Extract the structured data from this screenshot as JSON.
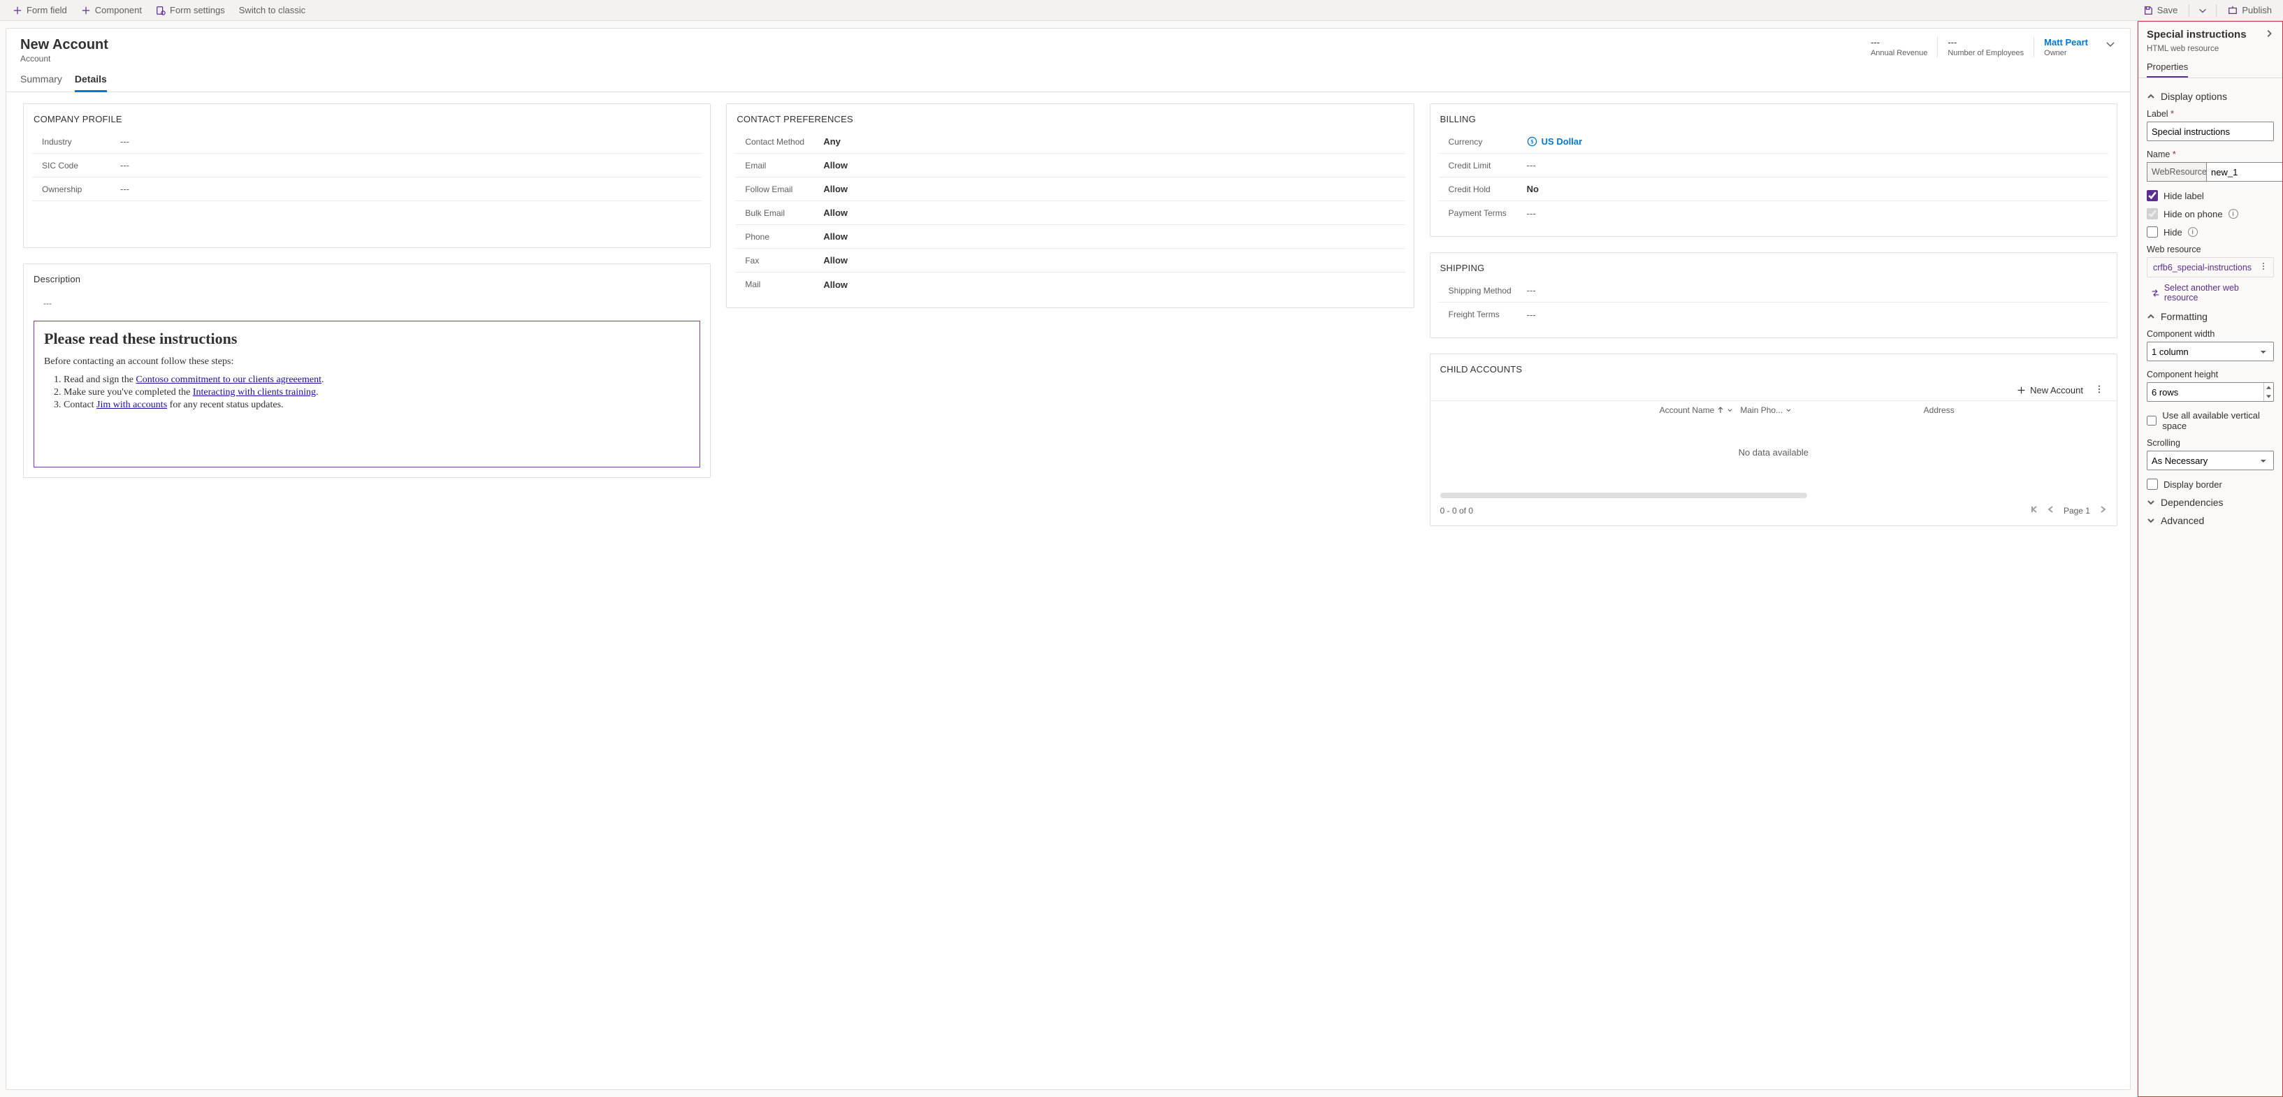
{
  "topbar": {
    "form_field": "Form field",
    "component": "Component",
    "form_settings": "Form settings",
    "switch_classic": "Switch to classic",
    "save": "Save",
    "publish": "Publish"
  },
  "header": {
    "title": "New Account",
    "subtitle": "Account",
    "fields": [
      {
        "value": "---",
        "label": "Annual Revenue"
      },
      {
        "value": "---",
        "label": "Number of Employees"
      },
      {
        "value": "Matt Peart",
        "label": "Owner",
        "link": true
      }
    ]
  },
  "tabs": {
    "summary": "Summary",
    "details": "Details"
  },
  "company_profile": {
    "title": "COMPANY PROFILE",
    "rows": [
      {
        "label": "Industry",
        "value": "---"
      },
      {
        "label": "SIC Code",
        "value": "---"
      },
      {
        "label": "Ownership",
        "value": "---"
      }
    ]
  },
  "contact_prefs": {
    "title": "CONTACT PREFERENCES",
    "rows": [
      {
        "label": "Contact Method",
        "value": "Any"
      },
      {
        "label": "Email",
        "value": "Allow"
      },
      {
        "label": "Follow Email",
        "value": "Allow"
      },
      {
        "label": "Bulk Email",
        "value": "Allow"
      },
      {
        "label": "Phone",
        "value": "Allow"
      },
      {
        "label": "Fax",
        "value": "Allow"
      },
      {
        "label": "Mail",
        "value": "Allow"
      }
    ]
  },
  "billing": {
    "title": "BILLING",
    "rows": [
      {
        "label": "Currency",
        "value": "US Dollar",
        "currency": true
      },
      {
        "label": "Credit Limit",
        "value": "---"
      },
      {
        "label": "Credit Hold",
        "value": "No"
      },
      {
        "label": "Payment Terms",
        "value": "---"
      }
    ]
  },
  "shipping": {
    "title": "SHIPPING",
    "rows": [
      {
        "label": "Shipping Method",
        "value": "---"
      },
      {
        "label": "Freight Terms",
        "value": "---"
      }
    ]
  },
  "description": {
    "title": "Description",
    "value": "---"
  },
  "webres": {
    "heading": "Please read these instructions",
    "intro": "Before contacting an account follow these steps:",
    "steps": {
      "s1a": "Read and sign the ",
      "s1link": "Contoso commitment to our clients agreeement",
      "s1b": ".",
      "s2a": "Make sure you've completed the ",
      "s2link": "Interacting with clients training",
      "s2b": ".",
      "s3a": "Contact ",
      "s3link": "Jim with accounts",
      "s3b": " for any recent status updates."
    }
  },
  "child_accounts": {
    "title": "CHILD ACCOUNTS",
    "add_label": "New Account",
    "columns": {
      "c1": "Account Name",
      "c2": "Main Pho...",
      "c3": "Address"
    },
    "empty": "No data available",
    "footer_count": "0 - 0 of 0",
    "page_label": "Page 1"
  },
  "props": {
    "title": "Special instructions",
    "subtitle": "HTML web resource",
    "tab": "Properties",
    "display_options": "Display options",
    "label_lbl": "Label",
    "label_val": "Special instructions",
    "name_lbl": "Name",
    "name_prefix": "WebResource_",
    "name_val": "new_1",
    "hide_label": "Hide label",
    "hide_on_phone": "Hide on phone",
    "hide": "Hide",
    "web_resource_lbl": "Web resource",
    "web_resource_val": "crfb6_special-instructions",
    "select_another": "Select another web resource",
    "formatting": "Formatting",
    "comp_width_lbl": "Component width",
    "comp_width_val": "1 column",
    "comp_height_lbl": "Component height",
    "comp_height_val": "6 rows",
    "use_all_vertical": "Use all available vertical space",
    "scrolling_lbl": "Scrolling",
    "scrolling_val": "As Necessary",
    "display_border": "Display border",
    "dependencies": "Dependencies",
    "advanced": "Advanced"
  }
}
